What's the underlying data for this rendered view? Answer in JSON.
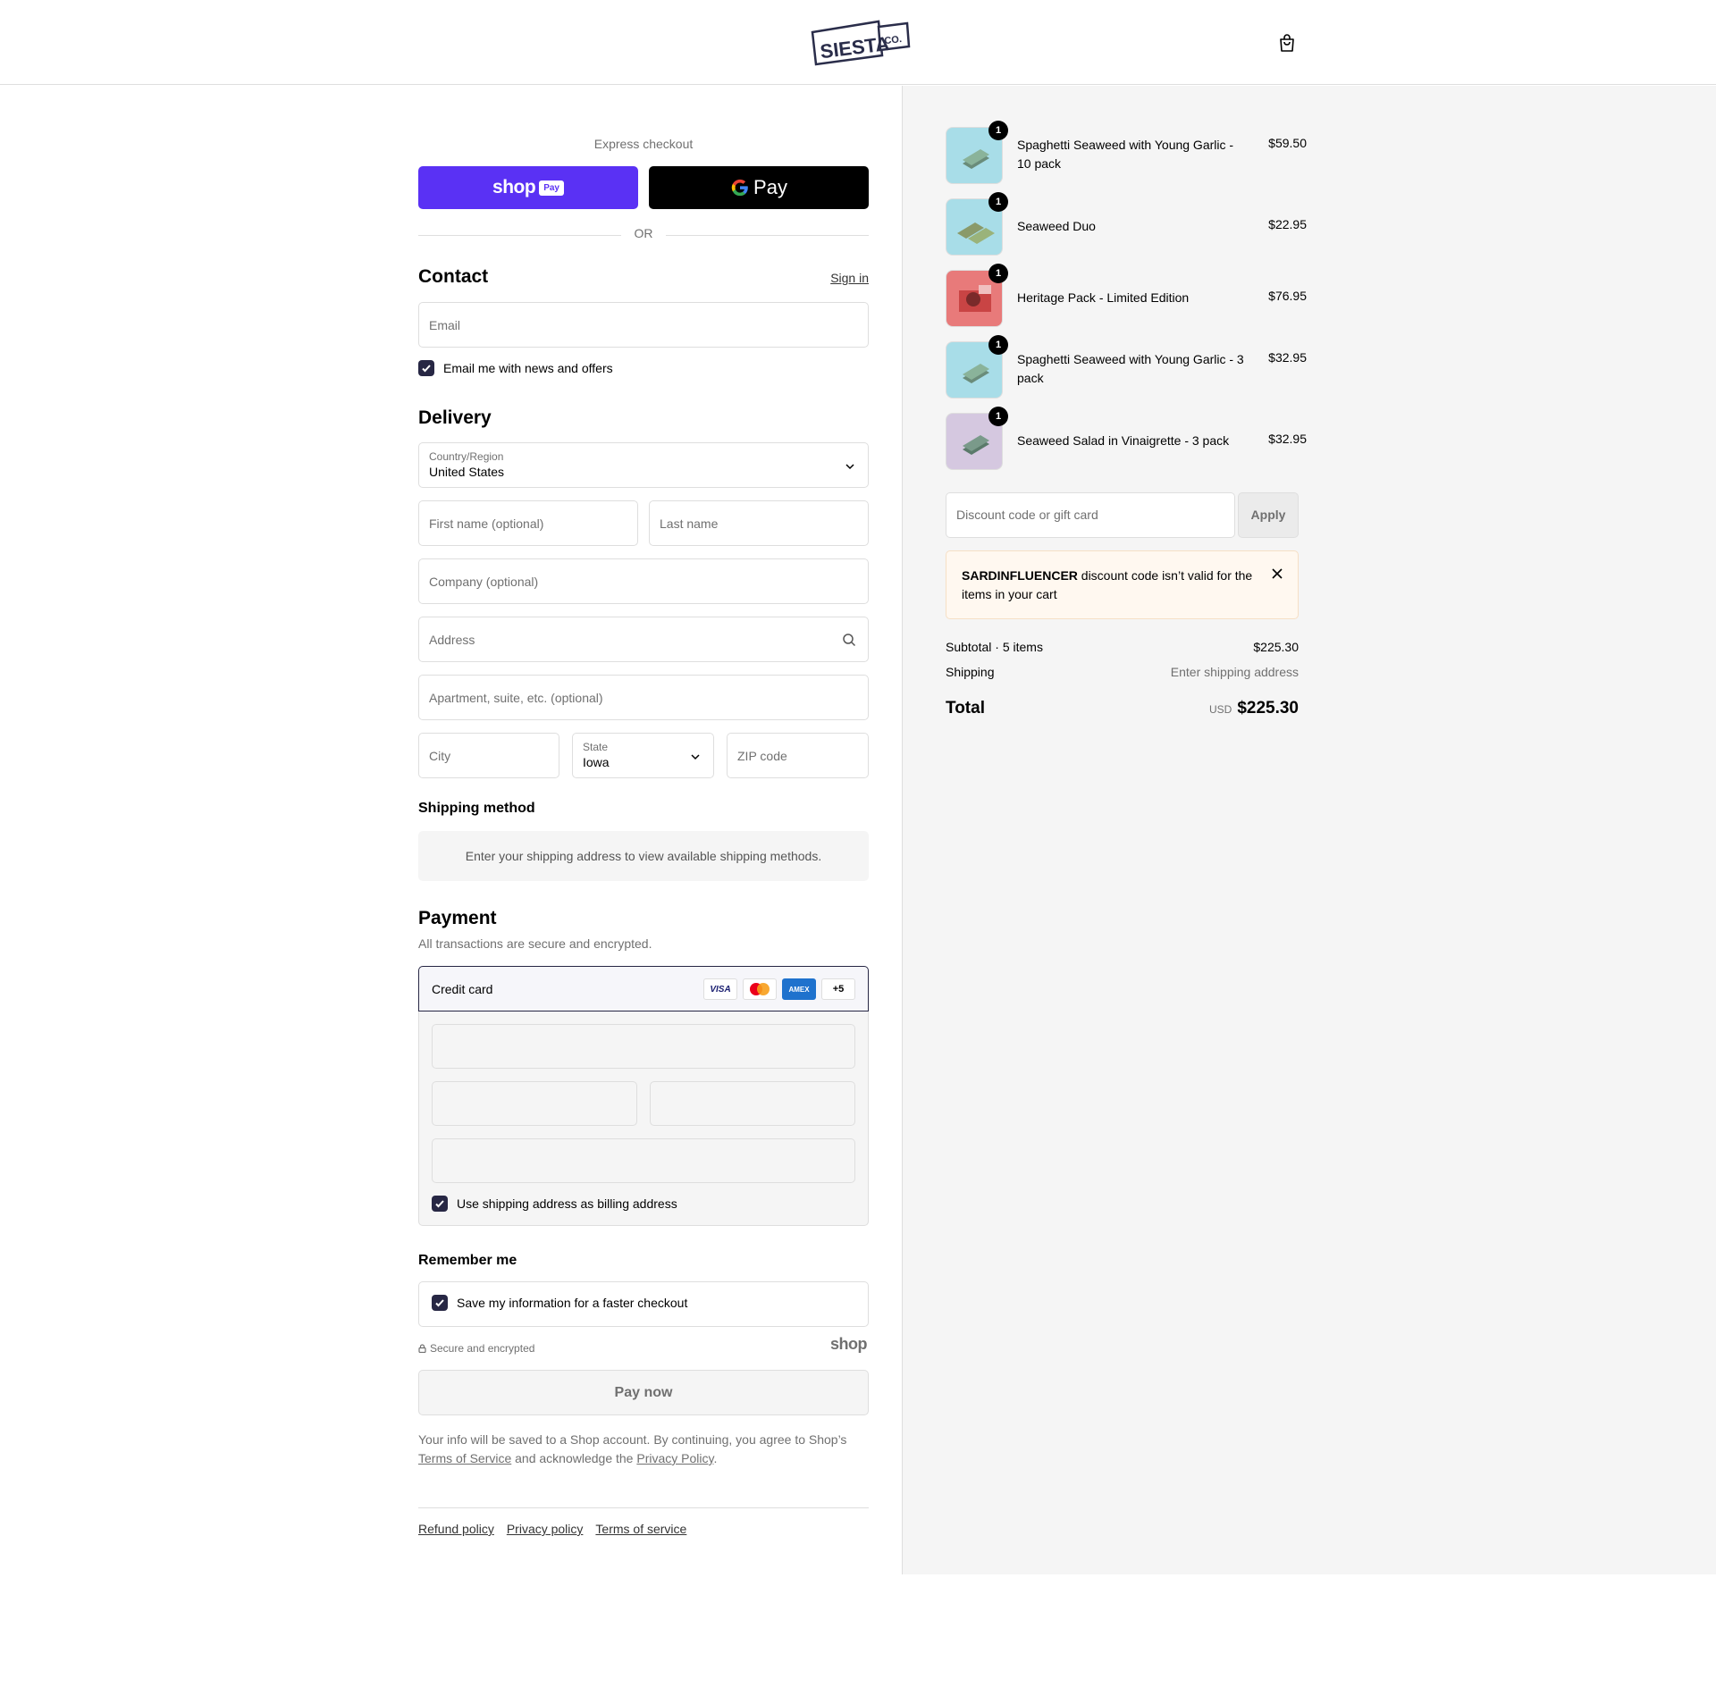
{
  "header": {
    "brand": "SIESTA CO."
  },
  "express": {
    "title": "Express checkout",
    "shoppay_word": "shop",
    "shoppay_pill": "Pay",
    "gpay_word": "Pay",
    "or": "OR"
  },
  "contact": {
    "heading": "Contact",
    "sign_in": "Sign in",
    "email_placeholder": "Email",
    "newsletter_label": "Email me with news and offers"
  },
  "delivery": {
    "heading": "Delivery",
    "country_label": "Country/Region",
    "country_value": "United States",
    "first_name": "First name (optional)",
    "last_name": "Last name",
    "company": "Company (optional)",
    "address": "Address",
    "apartment": "Apartment, suite, etc. (optional)",
    "city": "City",
    "state_label": "State",
    "state_value": "Iowa",
    "zip": "ZIP code"
  },
  "shipping_method": {
    "heading": "Shipping method",
    "message": "Enter your shipping address to view available shipping methods."
  },
  "payment": {
    "heading": "Payment",
    "subtitle": "All transactions are secure and encrypted.",
    "method": "Credit card",
    "cards": [
      "VISA",
      "MC",
      "AMEX",
      "+5"
    ],
    "billing_label": "Use shipping address as billing address"
  },
  "remember": {
    "heading": "Remember me",
    "label": "Save my information for a faster checkout"
  },
  "secure_text": "Secure and encrypted",
  "shop_mark": "shop",
  "pay_now": "Pay now",
  "legal": {
    "before": "Your info will be saved to a Shop account. By continuing, you agree to Shop’s ",
    "terms": "Terms of Service",
    "middle": " and acknowledge the ",
    "privacy": "Privacy Policy",
    "after": "."
  },
  "footer": {
    "refund": "Refund policy",
    "privacy": "Privacy policy",
    "terms": "Terms of service"
  },
  "summary": {
    "items": [
      {
        "name": "Spaghetti Seaweed with Young Garlic - 10 pack",
        "price": "$59.50",
        "qty": "1",
        "bg": "#a8dde8"
      },
      {
        "name": "Seaweed Duo",
        "price": "$22.95",
        "qty": "1",
        "bg": "#a8dde8"
      },
      {
        "name": "Heritage Pack - Limited Edition",
        "price": "$76.95",
        "qty": "1",
        "bg": "#e87a7a"
      },
      {
        "name": "Spaghetti Seaweed with Young Garlic - 3 pack",
        "price": "$32.95",
        "qty": "1",
        "bg": "#a8dde8"
      },
      {
        "name": "Seaweed Salad in Vinaigrette - 3 pack",
        "price": "$32.95",
        "qty": "1",
        "bg": "#d5c8e0"
      }
    ],
    "discount_placeholder": "Discount code or gift card",
    "apply": "Apply",
    "alert_code": "SARDINFLUENCER",
    "alert_msg": " discount code isn’t valid for the items in your cart",
    "subtotal_label": "Subtotal · 5 items",
    "subtotal_value": "$225.30",
    "shipping_label": "Shipping",
    "shipping_value": "Enter shipping address",
    "total_label": "Total",
    "currency": "USD",
    "total_value": "$225.30"
  }
}
